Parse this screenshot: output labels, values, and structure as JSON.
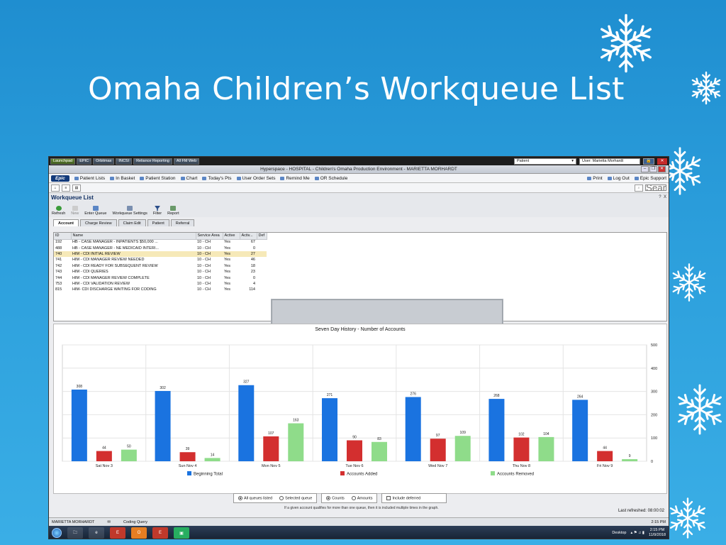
{
  "slide": {
    "title": "Omaha Children’s Workqueue List"
  },
  "topbar": {
    "buttons": [
      "Launchpad",
      "EPIC",
      "Orbitmax",
      "INCSI",
      "Reliance Reporting",
      "All FM Web"
    ],
    "patient_label": "Patient",
    "user_label": "User: Marietta Morhardt"
  },
  "titlebar": {
    "text": "Hyperspace - HOSPITAL - Children's Omaha Production Environment - MARIETTA MORHARDT"
  },
  "menu": {
    "logo": "Epic",
    "items": [
      "Patient Lists",
      "In Basket",
      "Patient Station",
      "Chart",
      "Today's Pts",
      "User Order Sets",
      "Remind Me",
      "OR Schedule"
    ],
    "right_items": [
      "Print",
      "Log Out",
      "Epic Support"
    ],
    "search_placeholder": "Search"
  },
  "activity": {
    "title": "Workqueue List",
    "help": "?",
    "close": "X",
    "toolbar": [
      "Refresh",
      "New",
      "Enter Queue",
      "Workqueue Settings",
      "Filter",
      "Report"
    ]
  },
  "tabs": [
    "Account",
    "Charge Review",
    "Claim Edit",
    "Patient",
    "Referral"
  ],
  "grid": {
    "columns": [
      "ID",
      "Name",
      "Service Area",
      "Active",
      "Activ...",
      "Def"
    ],
    "rows": [
      [
        "192",
        "HB - CASE MANAGER - INPATIENTS $50,000 ...",
        "10 - CH",
        "Yes",
        "67"
      ],
      [
        "488",
        "HB - CASE MANAGER - NE MEDICAID INTERI...",
        "10 - CH",
        "Yes",
        "0"
      ],
      [
        "740",
        "HIM - CDI INITIAL REVIEW",
        "10 - CH",
        "Yes",
        "27"
      ],
      [
        "741",
        "HIM - CDI MANAGER REVIEW NEEDED",
        "10 - CH",
        "Yes",
        "46"
      ],
      [
        "742",
        "HIM - CDI READY FOR SUBSEQUENT REVIEW",
        "10 - CH",
        "Yes",
        "18"
      ],
      [
        "743",
        "HIM - CDI QUERIES",
        "10 - CH",
        "Yes",
        "23"
      ],
      [
        "744",
        "HIM - CDI MANAGER REVIEW COMPLETE",
        "10 - CH",
        "Yes",
        "0"
      ],
      [
        "753",
        "HIM - CDI VALIDATION REVIEW",
        "10 - CH",
        "Yes",
        "4"
      ],
      [
        "815",
        "HIM- CDI DISCHARGE WAITING FOR CODING",
        "10 - CH",
        "Yes",
        "114"
      ]
    ],
    "selected_row": 2
  },
  "chart_data": {
    "type": "bar",
    "title": "Seven Day History - Number of Accounts",
    "categories": [
      "Sat Nov 3",
      "Sun Nov 4",
      "Mon Nov 5",
      "Tue Nov 6",
      "Wed Nov 7",
      "Thu Nov 8",
      "Fri Nov 9"
    ],
    "series": [
      {
        "name": "Beginning Total",
        "color": "#1a73e0",
        "values": [
          308,
          302,
          327,
          271,
          276,
          268,
          264
        ]
      },
      {
        "name": "Accounts Added",
        "color": "#d32f2f",
        "values": [
          44,
          39,
          107,
          90,
          97,
          102,
          44
        ]
      },
      {
        "name": "Accounts Removed",
        "color": "#8fdc8a",
        "values": [
          50,
          14,
          163,
          83,
          109,
          104,
          9
        ]
      }
    ],
    "ylim": [
      0,
      500
    ],
    "yticks": [
      0,
      100,
      200,
      300,
      400,
      500
    ],
    "grid": true,
    "legend": "bottom"
  },
  "controls": {
    "queue_options": [
      "All queues listed",
      "Selected queue"
    ],
    "queue_selected": 0,
    "measure_options": [
      "Counts",
      "Amounts"
    ],
    "measure_selected": 0,
    "include_deferred": "Include deferred",
    "note": "If a given account qualifies for more than one queue, then it is included multiple times in the graph.",
    "last_refreshed": "Last refreshed: 08:00:02"
  },
  "status": {
    "user": "MARIETTA MORHARDT",
    "mode": "Coding Query",
    "time": "2:15 PM"
  },
  "taskbar": {
    "desktop": "Desktop",
    "time": "2:15 PM",
    "date": "11/9/2018"
  }
}
